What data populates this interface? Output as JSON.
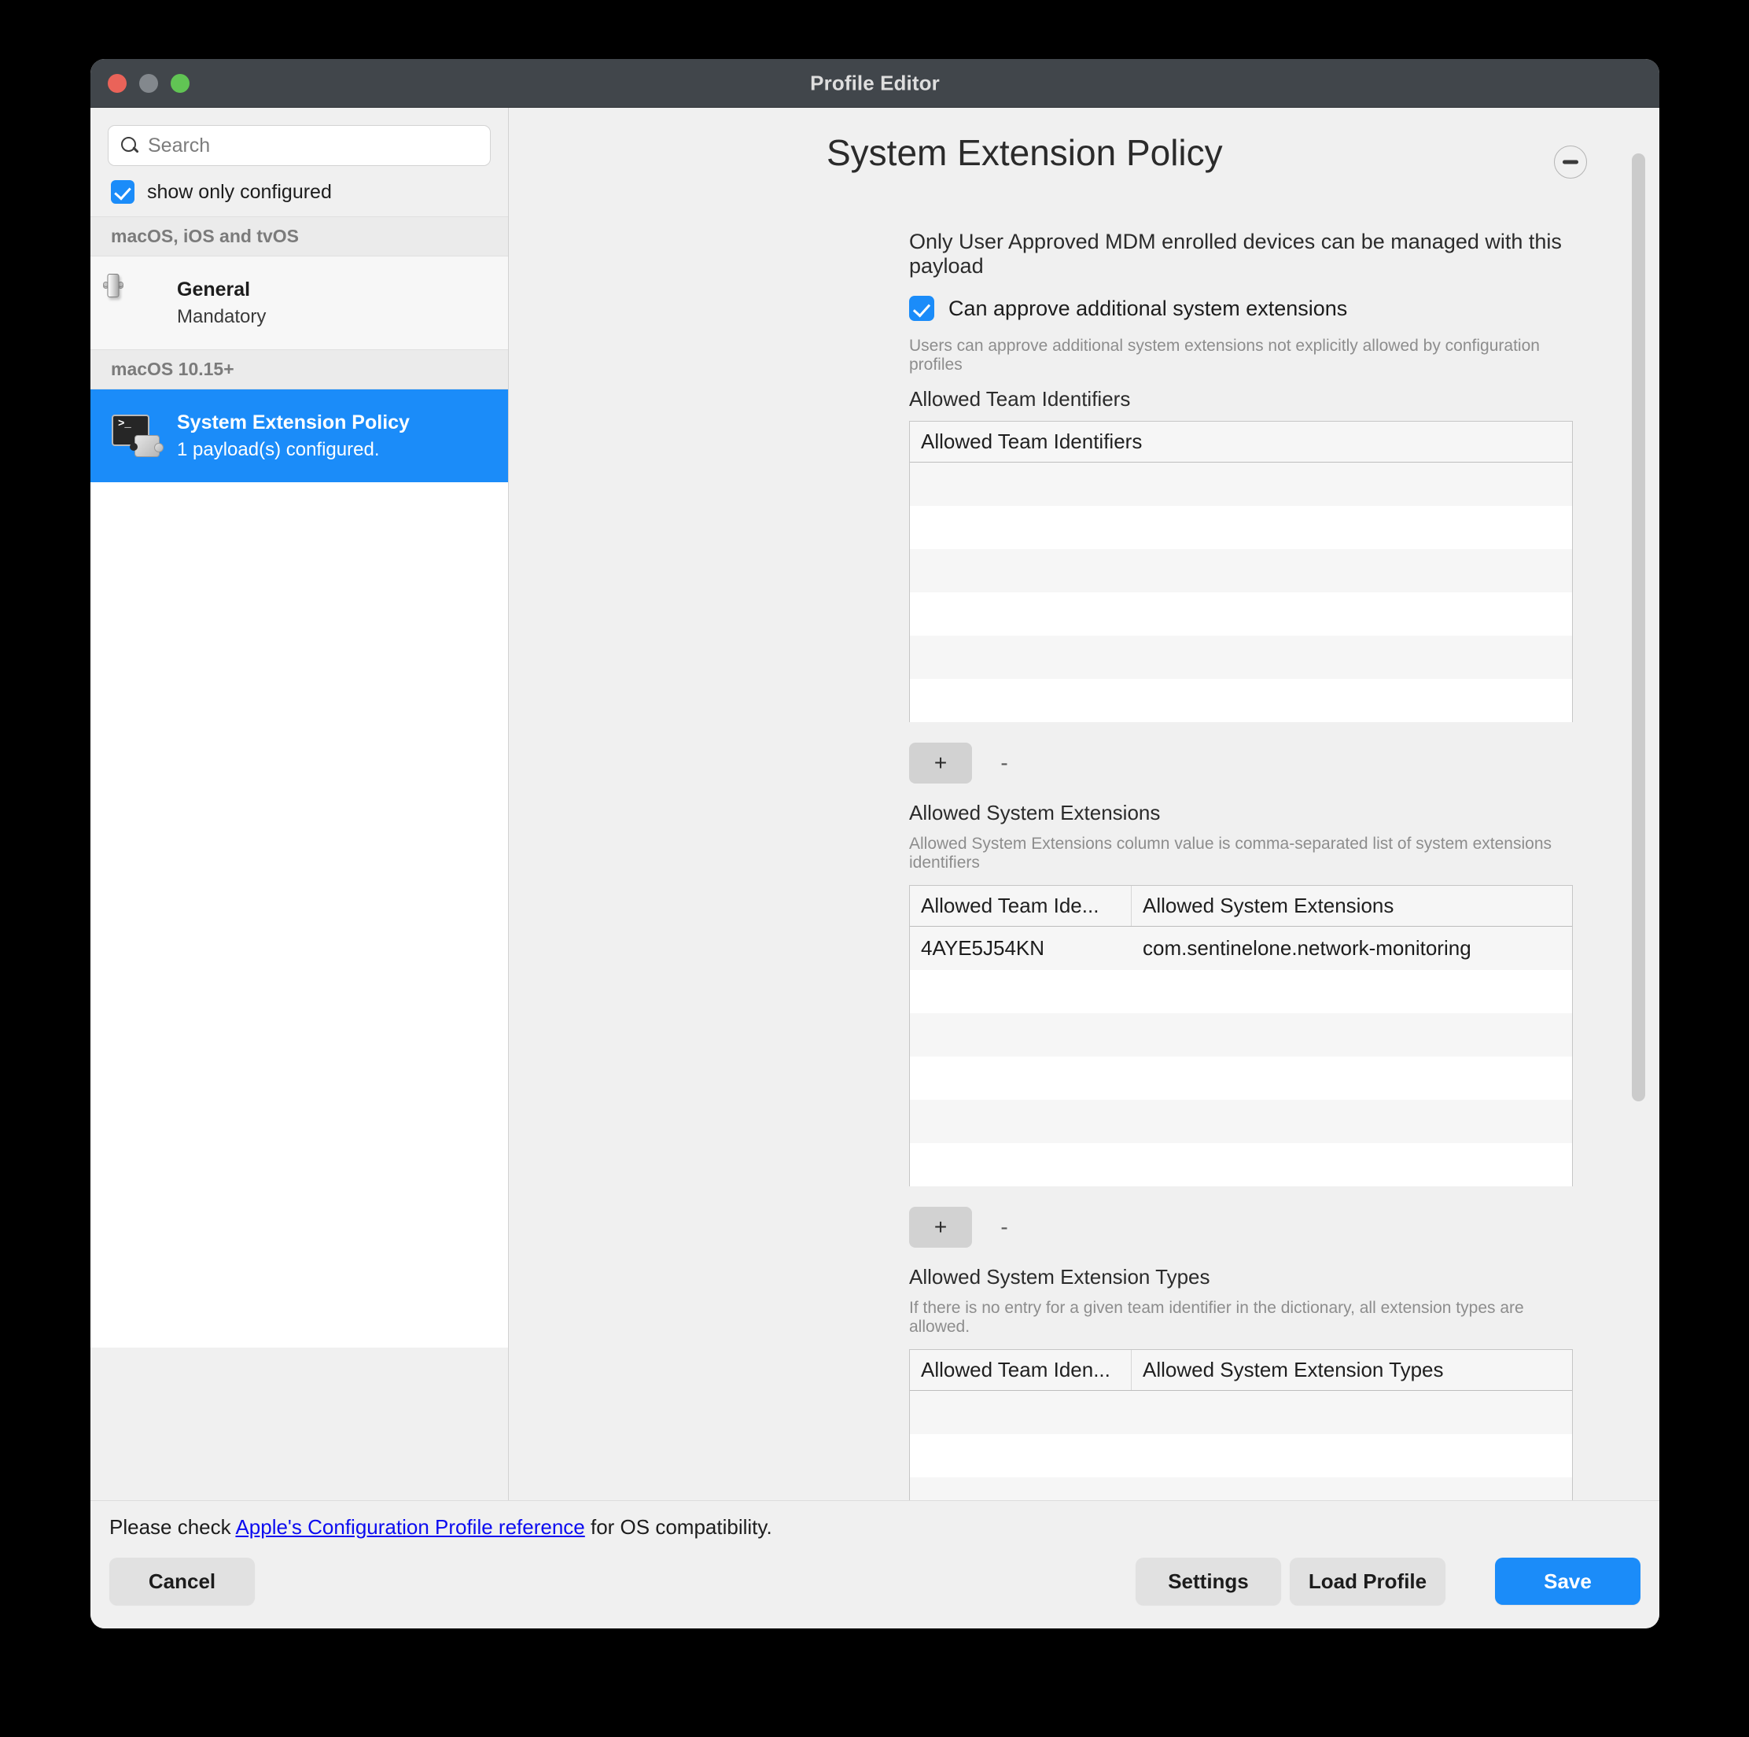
{
  "window": {
    "title": "Profile Editor",
    "traffic_lights": [
      "close-red",
      "minimize-yellow",
      "zoom-green"
    ]
  },
  "sidebar": {
    "search": {
      "placeholder": "Search",
      "value": "",
      "icon": "search-icon"
    },
    "show_only_configured": {
      "label": "show only configured",
      "checked": true
    },
    "groups": [
      {
        "header": "macOS, iOS and tvOS",
        "items": [
          {
            "title": "General",
            "subtitle": "Mandatory",
            "icon": "light-switch-icon",
            "selected": false
          }
        ]
      },
      {
        "header": "macOS 10.15+",
        "items": [
          {
            "title": "System Extension Policy",
            "subtitle": "1 payload(s) configured.",
            "icon": "terminal-puzzle-icon",
            "selected": true
          }
        ]
      }
    ]
  },
  "main": {
    "page_title": "System Extension Policy",
    "remove_payload_button": {
      "icon": "minus-circle-icon",
      "label": "−"
    },
    "note": "Only User Approved MDM enrolled devices can be managed with this payload",
    "can_approve": {
      "label": "Can approve additional system extensions",
      "checked": true,
      "hint": "Users can approve additional system extensions not explicitly allowed by configuration profiles"
    },
    "sections": [
      {
        "label": "Allowed Team Identifiers",
        "hint": "",
        "columns": [
          "Allowed Team Identifiers"
        ],
        "rows": [],
        "empty_row_count": 6,
        "add_label": "+",
        "remove_label": "-"
      },
      {
        "label": "Allowed System Extensions",
        "hint": "Allowed System Extensions column value is comma-separated list of system extensions identifiers",
        "columns": [
          "Allowed Team Ide...",
          "Allowed System Extensions"
        ],
        "rows": [
          [
            "4AYE5J54KN",
            "com.sentinelone.network-monitoring"
          ]
        ],
        "empty_row_count": 5,
        "add_label": "+",
        "remove_label": "-"
      },
      {
        "label": "Allowed System Extension Types",
        "hint": "If there is no entry for a given team identifier in the dictionary, all extension types are allowed.",
        "columns": [
          "Allowed Team Iden...",
          "Allowed System Extension Types"
        ],
        "rows": [],
        "empty_row_count": 5,
        "add_label": "+",
        "remove_label": "-"
      }
    ]
  },
  "footer": {
    "compat_prefix": "Please check ",
    "compat_link": "Apple's Configuration Profile reference",
    "compat_suffix": " for OS compatibility.",
    "cancel": "Cancel",
    "settings": "Settings",
    "load_profile": "Load Profile",
    "save": "Save"
  },
  "colors": {
    "accent": "#1b8cf9",
    "titlebar": "#41464b",
    "link": "#0b0bf0"
  }
}
